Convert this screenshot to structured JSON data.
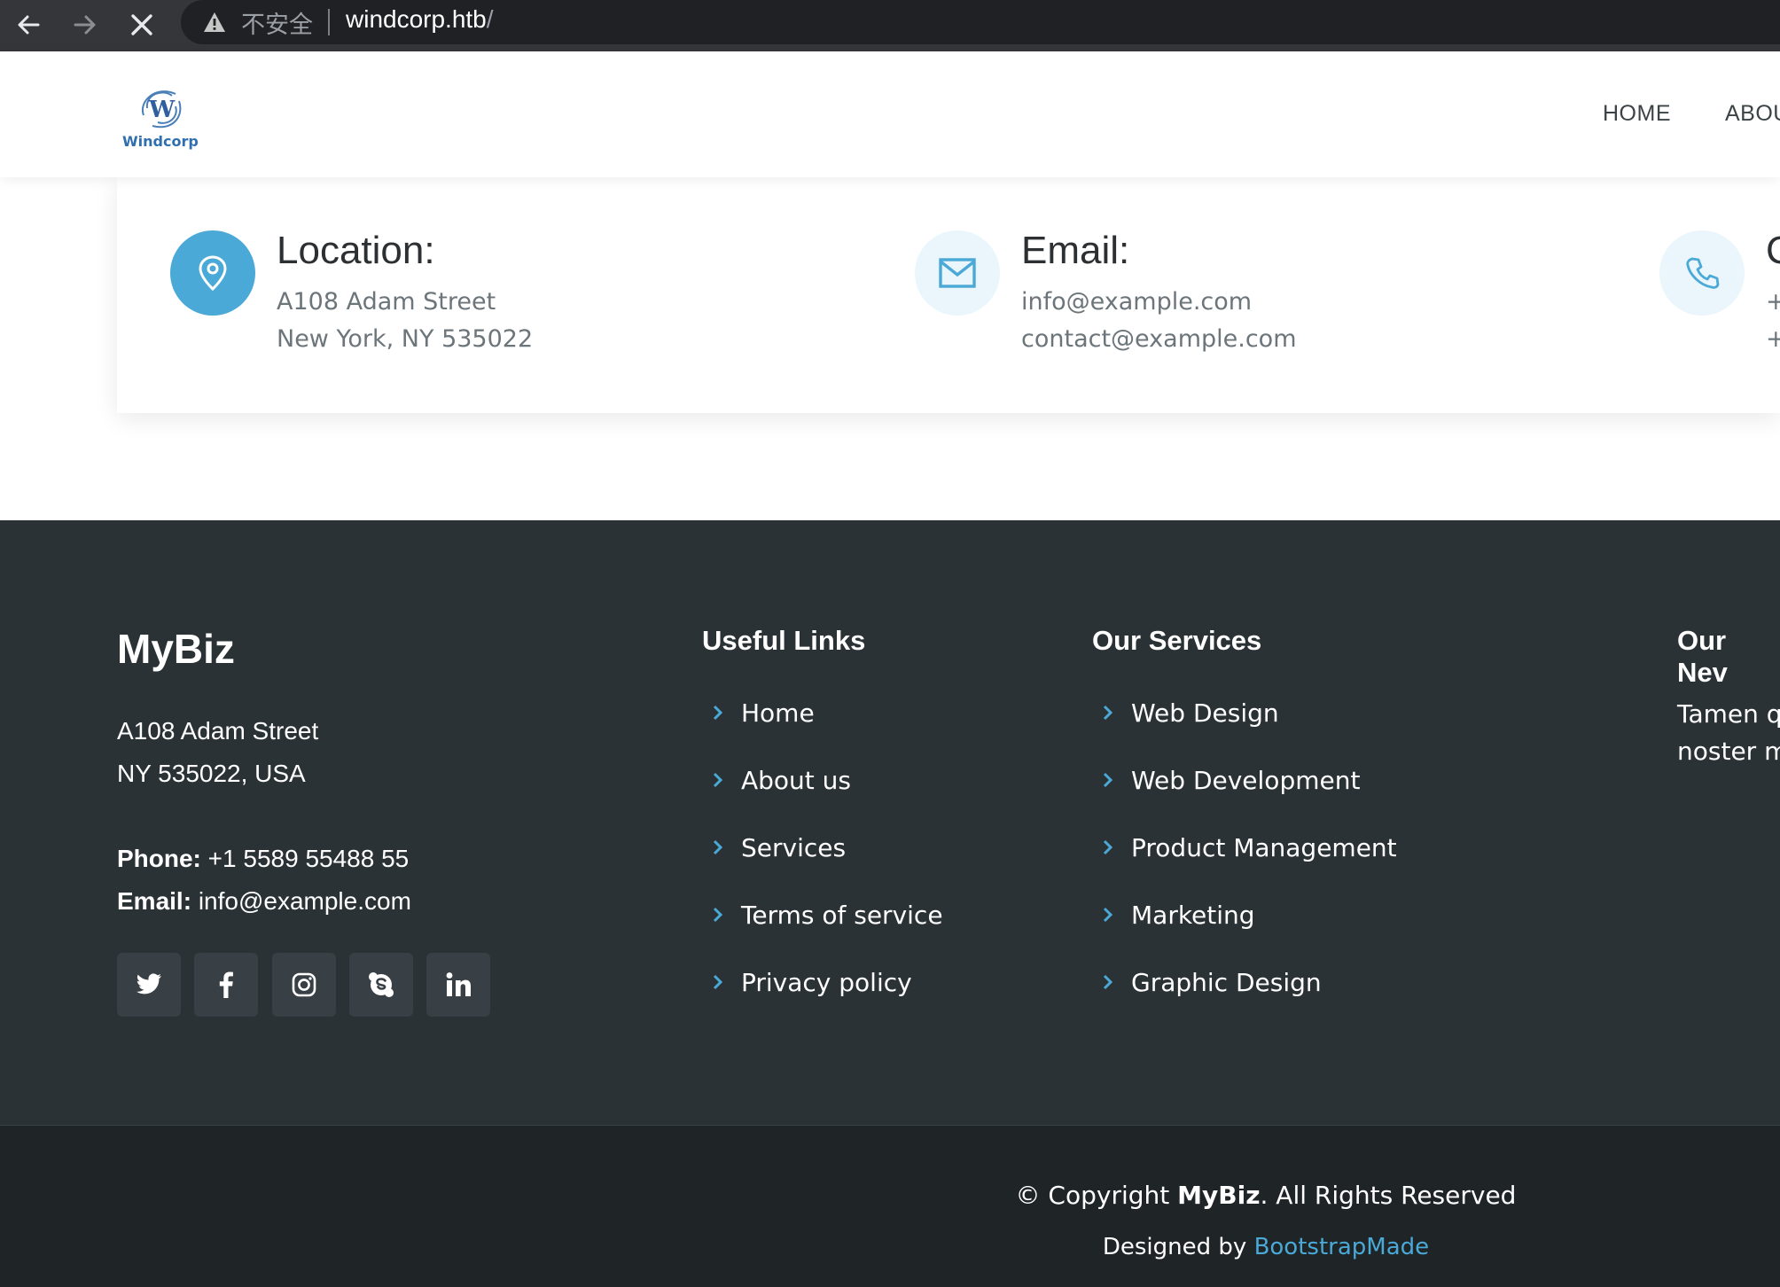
{
  "browser": {
    "security_label": "不安全",
    "url_host": "windcorp.htb",
    "url_path": "/"
  },
  "header": {
    "logo_text": "Windcorp",
    "nav": [
      "HOME",
      "ABOU"
    ]
  },
  "contact": [
    {
      "title": "Location:",
      "lines": [
        "A108 Adam Street",
        "New York, NY 535022"
      ],
      "icon": "map-pin-icon"
    },
    {
      "title": "Email:",
      "lines": [
        "info@example.com",
        "contact@example.com"
      ],
      "icon": "envelope-icon"
    },
    {
      "title": "C",
      "lines": [
        "+",
        "+"
      ],
      "icon": "phone-icon"
    }
  ],
  "footer": {
    "brand": "MyBiz",
    "address_lines": [
      "A108 Adam Street",
      "NY 535022, USA"
    ],
    "phone_label": "Phone:",
    "phone": "+1 5589 55488 55",
    "email_label": "Email:",
    "email": "info@example.com",
    "social": [
      "twitter-icon",
      "facebook-icon",
      "instagram-icon",
      "skype-icon",
      "linkedin-icon"
    ],
    "useful_links": {
      "title": "Useful Links",
      "items": [
        "Home",
        "About us",
        "Services",
        "Terms of service",
        "Privacy policy"
      ]
    },
    "services": {
      "title": "Our Services",
      "items": [
        "Web Design",
        "Web Development",
        "Product Management",
        "Marketing",
        "Graphic Design"
      ]
    },
    "newsletter": {
      "title": "Our Nev",
      "lines": [
        "Tamen q",
        "noster m"
      ]
    },
    "copyright_prefix": "© Copyright ",
    "copyright_brand": "MyBiz",
    "copyright_suffix": ". All Rights Reserved",
    "designed_prefix": "Designed by ",
    "designed_link": "BootstrapMade"
  },
  "colors": {
    "accent": "#4aa9d6",
    "footer_bg": "#2b3236",
    "footer_bottom_bg": "#1f2427",
    "chrome_bg": "#35363a"
  }
}
